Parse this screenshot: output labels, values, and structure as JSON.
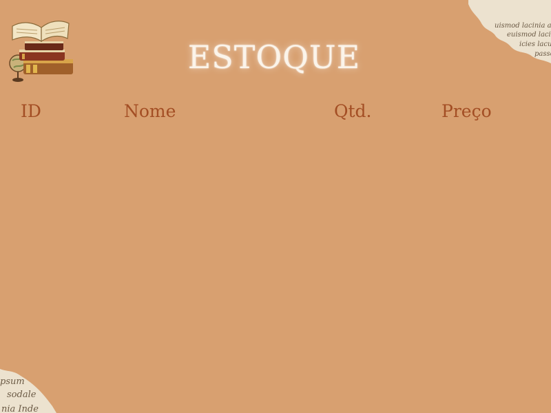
{
  "page": {
    "title": "ESTOQUE"
  },
  "table": {
    "columns": [
      "ID",
      "Nome",
      "Qtd.",
      "Preço"
    ],
    "rows": []
  },
  "decor": {
    "logo_icon": "books-and-globe-icon",
    "paper_top_right": [
      "uismod lacinia a",
      "euismod lacin",
      "icies lacu",
      "passe"
    ],
    "paper_bottom_left": [
      "psum",
      "sodale",
      "nia Inde"
    ]
  },
  "colors": {
    "background": "#d8a070",
    "header_text": "#a34e24",
    "title_text": "#fbf4ea"
  }
}
